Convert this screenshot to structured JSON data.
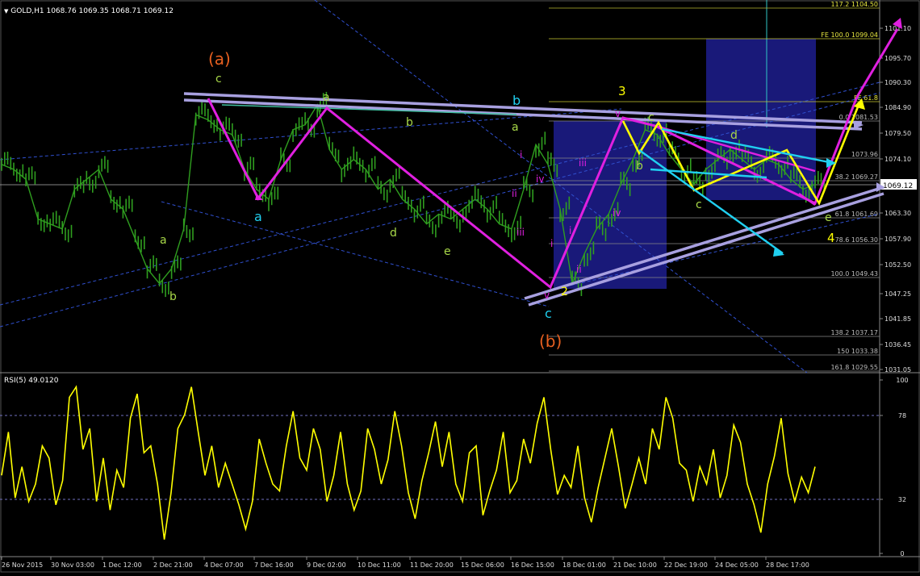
{
  "header": {
    "symbol_line": "GOLD,H1  1068.76 1069.35 1068.71 1069.12",
    "rsi_label": "RSI(5) 49.0120"
  },
  "colors": {
    "background": "#000000",
    "candles": "#2f9e1f",
    "rsi_line": "#ffff00",
    "wave_magenta": "#e020e0",
    "wave_yellow": "#ffff00",
    "wave_cyan": "#20d0f0",
    "trend_lavender": "#a8a0e0",
    "fib_box": "#1a1a80",
    "dashed_blue": "#3050d0"
  },
  "chart_data": [
    {
      "type": "line",
      "name": "price-panel",
      "y_ticks": [
        "1101.10",
        "1095.70",
        "1090.30",
        "1084.90",
        "1079.50",
        "1074.10",
        "1069.12",
        "1063.30",
        "1057.90",
        "1052.50",
        "1047.25",
        "1041.85",
        "1036.45",
        "1031.05"
      ],
      "ylim": [
        1031.05,
        1104.5
      ],
      "x_ticks": [
        "26 Nov 2015",
        "30 Nov 03:00",
        "1 Dec 12:00",
        "2 Dec 21:00",
        "4 Dec 07:00",
        "7 Dec 16:00",
        "9 Dec 02:00",
        "10 Dec 11:00",
        "11 Dec 20:00",
        "15 Dec 06:00",
        "16 Dec 15:00",
        "18 Dec 01:00",
        "21 Dec 10:00",
        "22 Dec 19:00",
        "24 Dec 05:00",
        "28 Dec 17:00"
      ],
      "current_price": "1069.12",
      "price_approx": [
        1073,
        1072,
        1070,
        1062,
        1061,
        1060,
        1068,
        1070,
        1072,
        1066,
        1064,
        1058,
        1052,
        1049,
        1052,
        1060,
        1083,
        1082,
        1080,
        1079,
        1072,
        1068,
        1066,
        1074,
        1080,
        1081,
        1085,
        1076,
        1072,
        1074,
        1072,
        1068,
        1070,
        1066,
        1064,
        1061,
        1063,
        1062,
        1064,
        1066,
        1064,
        1061,
        1060,
        1068,
        1077,
        1073,
        1064,
        1049,
        1055,
        1060,
        1063,
        1069,
        1074,
        1080,
        1079,
        1075,
        1072,
        1069,
        1072,
        1074,
        1076,
        1074,
        1072,
        1074,
        1073,
        1070,
        1068,
        1069
      ],
      "fib_labels": [
        "FE 100.0 1099.04",
        "FE 61.8",
        "0.0 1081.53",
        "1073.96",
        "38.2 1069.27",
        "61.8 1061.69",
        "78.6 1056.30",
        "100.0 1049.43",
        "138.2 1037.17",
        "150 1033.38"
      ],
      "fib_top_partial": "117.2 1104.50",
      "fib_bottom_partial": "161.8 1029.55",
      "wave_labels": {
        "orange": [
          "(a)",
          "(b)"
        ],
        "yellow_big": [
          "3",
          "4"
        ],
        "green": [
          "c",
          "a",
          "b",
          "a",
          "c",
          "b",
          "d",
          "e",
          "a",
          "b",
          "c",
          "d",
          "e"
        ],
        "cyan": [
          "a",
          "b",
          "c"
        ],
        "magenta": [
          "i",
          "ii",
          "iii",
          "iv",
          "v",
          "iii",
          "iv",
          "i",
          "ii",
          "i",
          "v"
        ],
        "number2": "2"
      }
    },
    {
      "type": "line",
      "name": "rsi-panel",
      "title": "RSI(5) 49.0120",
      "y_ticks": [
        "100",
        "78",
        "32",
        "0"
      ],
      "ylim": [
        0,
        100
      ],
      "levels": [
        78,
        32
      ],
      "values_approx": [
        45,
        70,
        32,
        50,
        30,
        40,
        62,
        55,
        28,
        42,
        90,
        96,
        60,
        72,
        30,
        55,
        25,
        48,
        38,
        78,
        92,
        58,
        62,
        40,
        8,
        35,
        72,
        80,
        96,
        70,
        45,
        62,
        38,
        52,
        40,
        28,
        14,
        30,
        66,
        52,
        40,
        36,
        62,
        82,
        55,
        48,
        72,
        60,
        30,
        45,
        70,
        40,
        25,
        36,
        72,
        60,
        40,
        54,
        82,
        62,
        35,
        20,
        42,
        58,
        76,
        50,
        70,
        40,
        30,
        58,
        62,
        22,
        36,
        48,
        70,
        35,
        42,
        66,
        52,
        75,
        90,
        60,
        34,
        45,
        38,
        62,
        32,
        18,
        38,
        55,
        72,
        50,
        26,
        40,
        55,
        40,
        72,
        60,
        90,
        78,
        52,
        48,
        30,
        50,
        40,
        60,
        32,
        45,
        74,
        64,
        40,
        28,
        12,
        40,
        56,
        78,
        46,
        30,
        44,
        35,
        50
      ]
    }
  ]
}
